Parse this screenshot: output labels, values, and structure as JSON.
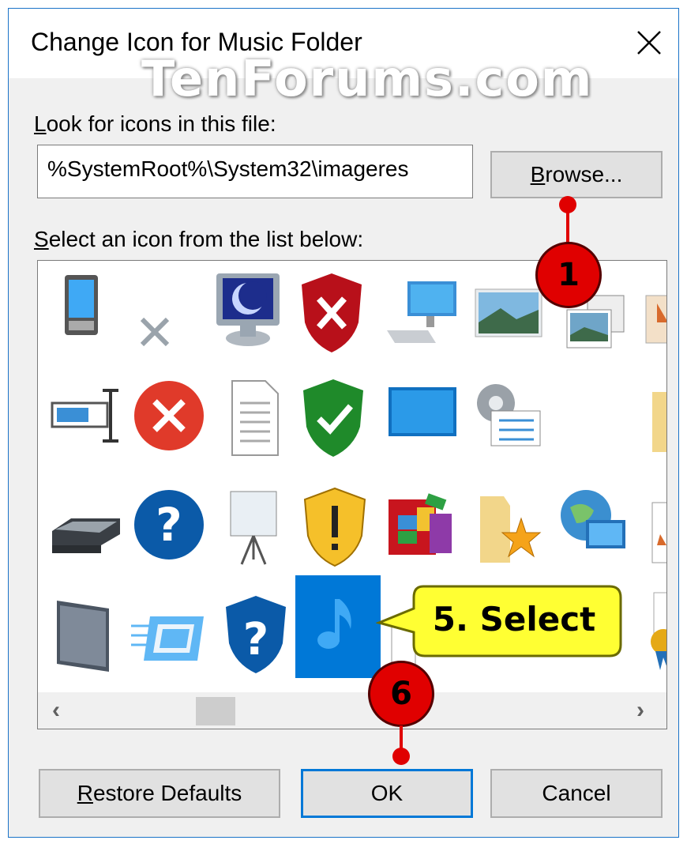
{
  "window": {
    "title": "Change Icon for Music Folder",
    "watermark": "TenForums.com"
  },
  "file_section": {
    "label_prefix": "L",
    "label_rest": "ook for icons in this file:",
    "path_value": "%SystemRoot%\\System32\\imageres",
    "browse_prefix": "B",
    "browse_rest": "rowse..."
  },
  "list_section": {
    "label_prefix": "S",
    "label_rest": "elect an icon from the list below:",
    "icons": [
      "pda-icon",
      "x-mark-icon",
      "monitor-moon-icon",
      "shield-red-x-icon",
      "desktop-computer-icon",
      "landscape-picture-icon",
      "pictures-stack-icon",
      "partial-icon",
      "text-field-icon",
      "error-circle-icon",
      "document-icon",
      "shield-green-check-icon",
      "display-icon",
      "settings-checklist-icon",
      "blank-icon",
      "folder-partial-icon",
      "scanner-icon",
      "help-circle-icon",
      "projector-screen-icon",
      "shield-warning-icon",
      "programs-icon",
      "favorite-folder-icon",
      "network-globe-icon",
      "document-partial-icon",
      "tablet-icon",
      "screen-motion-icon",
      "shield-help-icon",
      "music-note-icon",
      "document-partial-icon",
      "blank-icon",
      "blank-icon",
      "award-icon"
    ],
    "selected_icon": "music-note-icon"
  },
  "buttons": {
    "restore_prefix": "R",
    "restore_rest": "estore Defaults",
    "ok": "OK",
    "cancel": "Cancel"
  },
  "annotations": {
    "step1": "1",
    "step6": "6",
    "callout": "5. Select"
  },
  "colors": {
    "accent": "#0078d7",
    "badge": "#e00000",
    "callout": "#ffff33"
  }
}
